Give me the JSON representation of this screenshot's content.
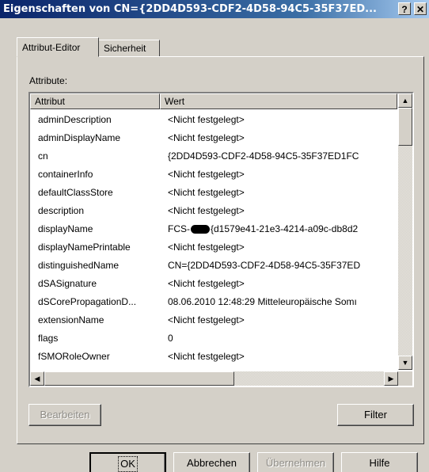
{
  "window": {
    "title": "Eigenschaften von CN={2DD4D593-CDF2-4D58-94C5-35F37ED...",
    "help_button": "?",
    "close_button": "✕"
  },
  "tabs": [
    {
      "label": "Attribut-Editor",
      "active": true
    },
    {
      "label": "Sicherheit",
      "active": false
    }
  ],
  "attributes_label": "Attribute:",
  "columns": {
    "attribute": "Attribut",
    "value": "Wert"
  },
  "rows": [
    {
      "name": "adminDescription",
      "value": "<Nicht festgelegt>"
    },
    {
      "name": "adminDisplayName",
      "value": "<Nicht festgelegt>"
    },
    {
      "name": "cn",
      "value": "{2DD4D593-CDF2-4D58-94C5-35F37ED1FC"
    },
    {
      "name": "containerInfo",
      "value": "<Nicht festgelegt>"
    },
    {
      "name": "defaultClassStore",
      "value": "<Nicht festgelegt>"
    },
    {
      "name": "description",
      "value": "<Nicht festgelegt>"
    },
    {
      "name": "displayName",
      "value_prefix": "FCS-",
      "value": "{d1579e41-21e3-4214-a09c-db8d2"
    },
    {
      "name": "displayNamePrintable",
      "value": "<Nicht festgelegt>"
    },
    {
      "name": "distinguishedName",
      "value": "CN={2DD4D593-CDF2-4D58-94C5-35F37ED"
    },
    {
      "name": "dSASignature",
      "value": "<Nicht festgelegt>"
    },
    {
      "name": "dSCorePropagationD...",
      "value": "08.06.2010 12:48:29 Mitteleuropäische Somı"
    },
    {
      "name": "extensionName",
      "value": "<Nicht festgelegt>"
    },
    {
      "name": "flags",
      "value": "0"
    },
    {
      "name": "fSMORoleOwner",
      "value": "<Nicht festgelegt>"
    }
  ],
  "buttons": {
    "edit": "Bearbeiten",
    "filter": "Filter",
    "ok": "OK",
    "cancel": "Abbrechen",
    "apply": "Übernehmen",
    "help": "Hilfe"
  },
  "scroll_icons": {
    "up": "arrow-up-icon",
    "down": "arrow-down-icon",
    "left": "arrow-left-icon",
    "right": "arrow-right-icon"
  }
}
